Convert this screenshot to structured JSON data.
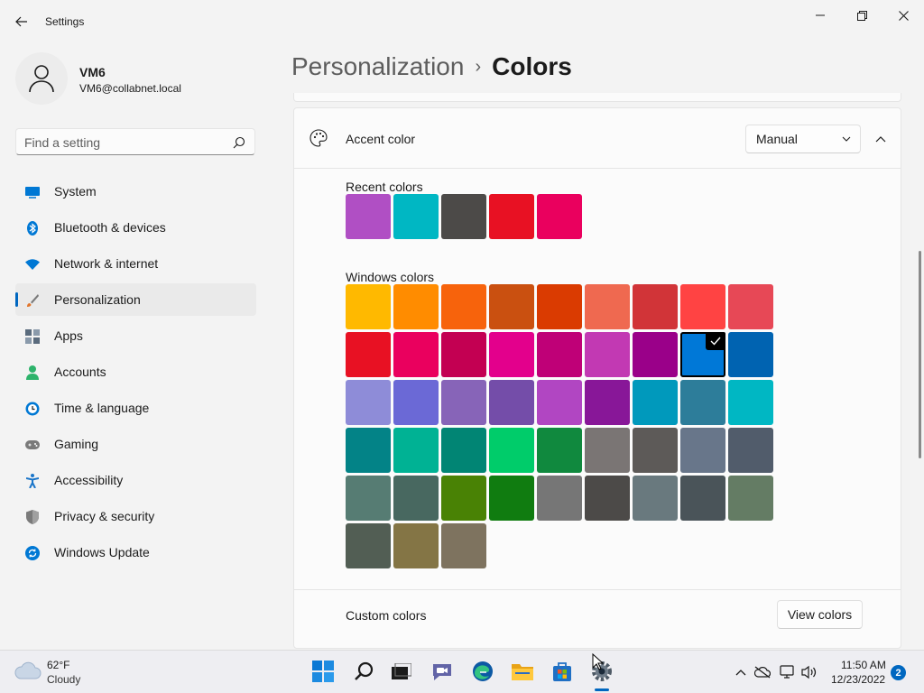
{
  "window": {
    "title": "Settings",
    "back_icon": "arrow-left-icon",
    "controls": [
      "minimize-icon",
      "restore-icon",
      "close-icon"
    ]
  },
  "profile": {
    "name": "VM6",
    "email": "VM6@collabnet.local"
  },
  "search": {
    "placeholder": "Find a setting"
  },
  "sidebar": {
    "items": [
      {
        "label": "System",
        "icon": "system-monitor-icon",
        "color": "#0078d4"
      },
      {
        "label": "Bluetooth & devices",
        "icon": "bluetooth-icon",
        "color": "#0078d4"
      },
      {
        "label": "Network & internet",
        "icon": "wifi-icon",
        "color": "#0078d4"
      },
      {
        "label": "Personalization",
        "icon": "paintbrush-icon",
        "color": "#e1752b",
        "active": true
      },
      {
        "label": "Apps",
        "icon": "apps-icon",
        "color": "#5a6b7d"
      },
      {
        "label": "Accounts",
        "icon": "accounts-icon",
        "color": "#2db36b"
      },
      {
        "label": "Time & language",
        "icon": "clock-globe-icon",
        "color": "#0078d4"
      },
      {
        "label": "Gaming",
        "icon": "gamepad-icon",
        "color": "#7a7a7a"
      },
      {
        "label": "Accessibility",
        "icon": "accessibility-icon",
        "color": "#1a75c9"
      },
      {
        "label": "Privacy & security",
        "icon": "shield-icon",
        "color": "#7a7a7a"
      },
      {
        "label": "Windows Update",
        "icon": "update-icon",
        "color": "#0078d4"
      }
    ]
  },
  "breadcrumb": {
    "parent": "Personalization",
    "separator": "›",
    "current": "Colors"
  },
  "accent": {
    "title": "Accent color",
    "mode": "Manual",
    "recent_label": "Recent colors",
    "recent_colors": [
      "#b04fc4",
      "#00b7c3",
      "#4c4a48",
      "#e81123",
      "#ea005e"
    ],
    "windows_label": "Windows colors",
    "windows_colors": [
      [
        "#ffb900",
        "#ff8c00",
        "#f7630c",
        "#ca5010",
        "#da3b01",
        "#ef6950",
        "#d13438",
        "#ff4343",
        "#e74856"
      ],
      [
        "#e81123",
        "#ea005e",
        "#c30052",
        "#e3008c",
        "#bf0077",
        "#c239b3",
        "#9a0089",
        "#0078d7",
        "#0063b1"
      ],
      [
        "#8e8cd8",
        "#6b69d6",
        "#8764b8",
        "#744da9",
        "#b146c2",
        "#881798",
        "#0099bc",
        "#2d7d9a",
        "#00b7c3"
      ],
      [
        "#038387",
        "#00b294",
        "#018574",
        "#00cc6a",
        "#10893e",
        "#7a7574",
        "#5d5a58",
        "#68768a",
        "#515c6b"
      ],
      [
        "#567c73",
        "#486860",
        "#498205",
        "#107c10",
        "#767676",
        "#4c4a48",
        "#69797e",
        "#4a5459",
        "#647c64"
      ],
      [
        "#525e54",
        "#847545",
        "#7e735f"
      ]
    ],
    "selected": {
      "row": 1,
      "col": 7
    },
    "custom_label": "Custom colors",
    "view_colors_label": "View colors"
  },
  "taskbar": {
    "weather_temp": "62°F",
    "weather_desc": "Cloudy",
    "apps": [
      {
        "name": "start-icon"
      },
      {
        "name": "search-icon"
      },
      {
        "name": "task-view-icon"
      },
      {
        "name": "chat-icon"
      },
      {
        "name": "edge-icon"
      },
      {
        "name": "file-explorer-icon"
      },
      {
        "name": "store-icon"
      },
      {
        "name": "settings-icon",
        "running": true
      }
    ],
    "time": "11:50 AM",
    "date": "12/23/2022",
    "notifications": "2"
  }
}
